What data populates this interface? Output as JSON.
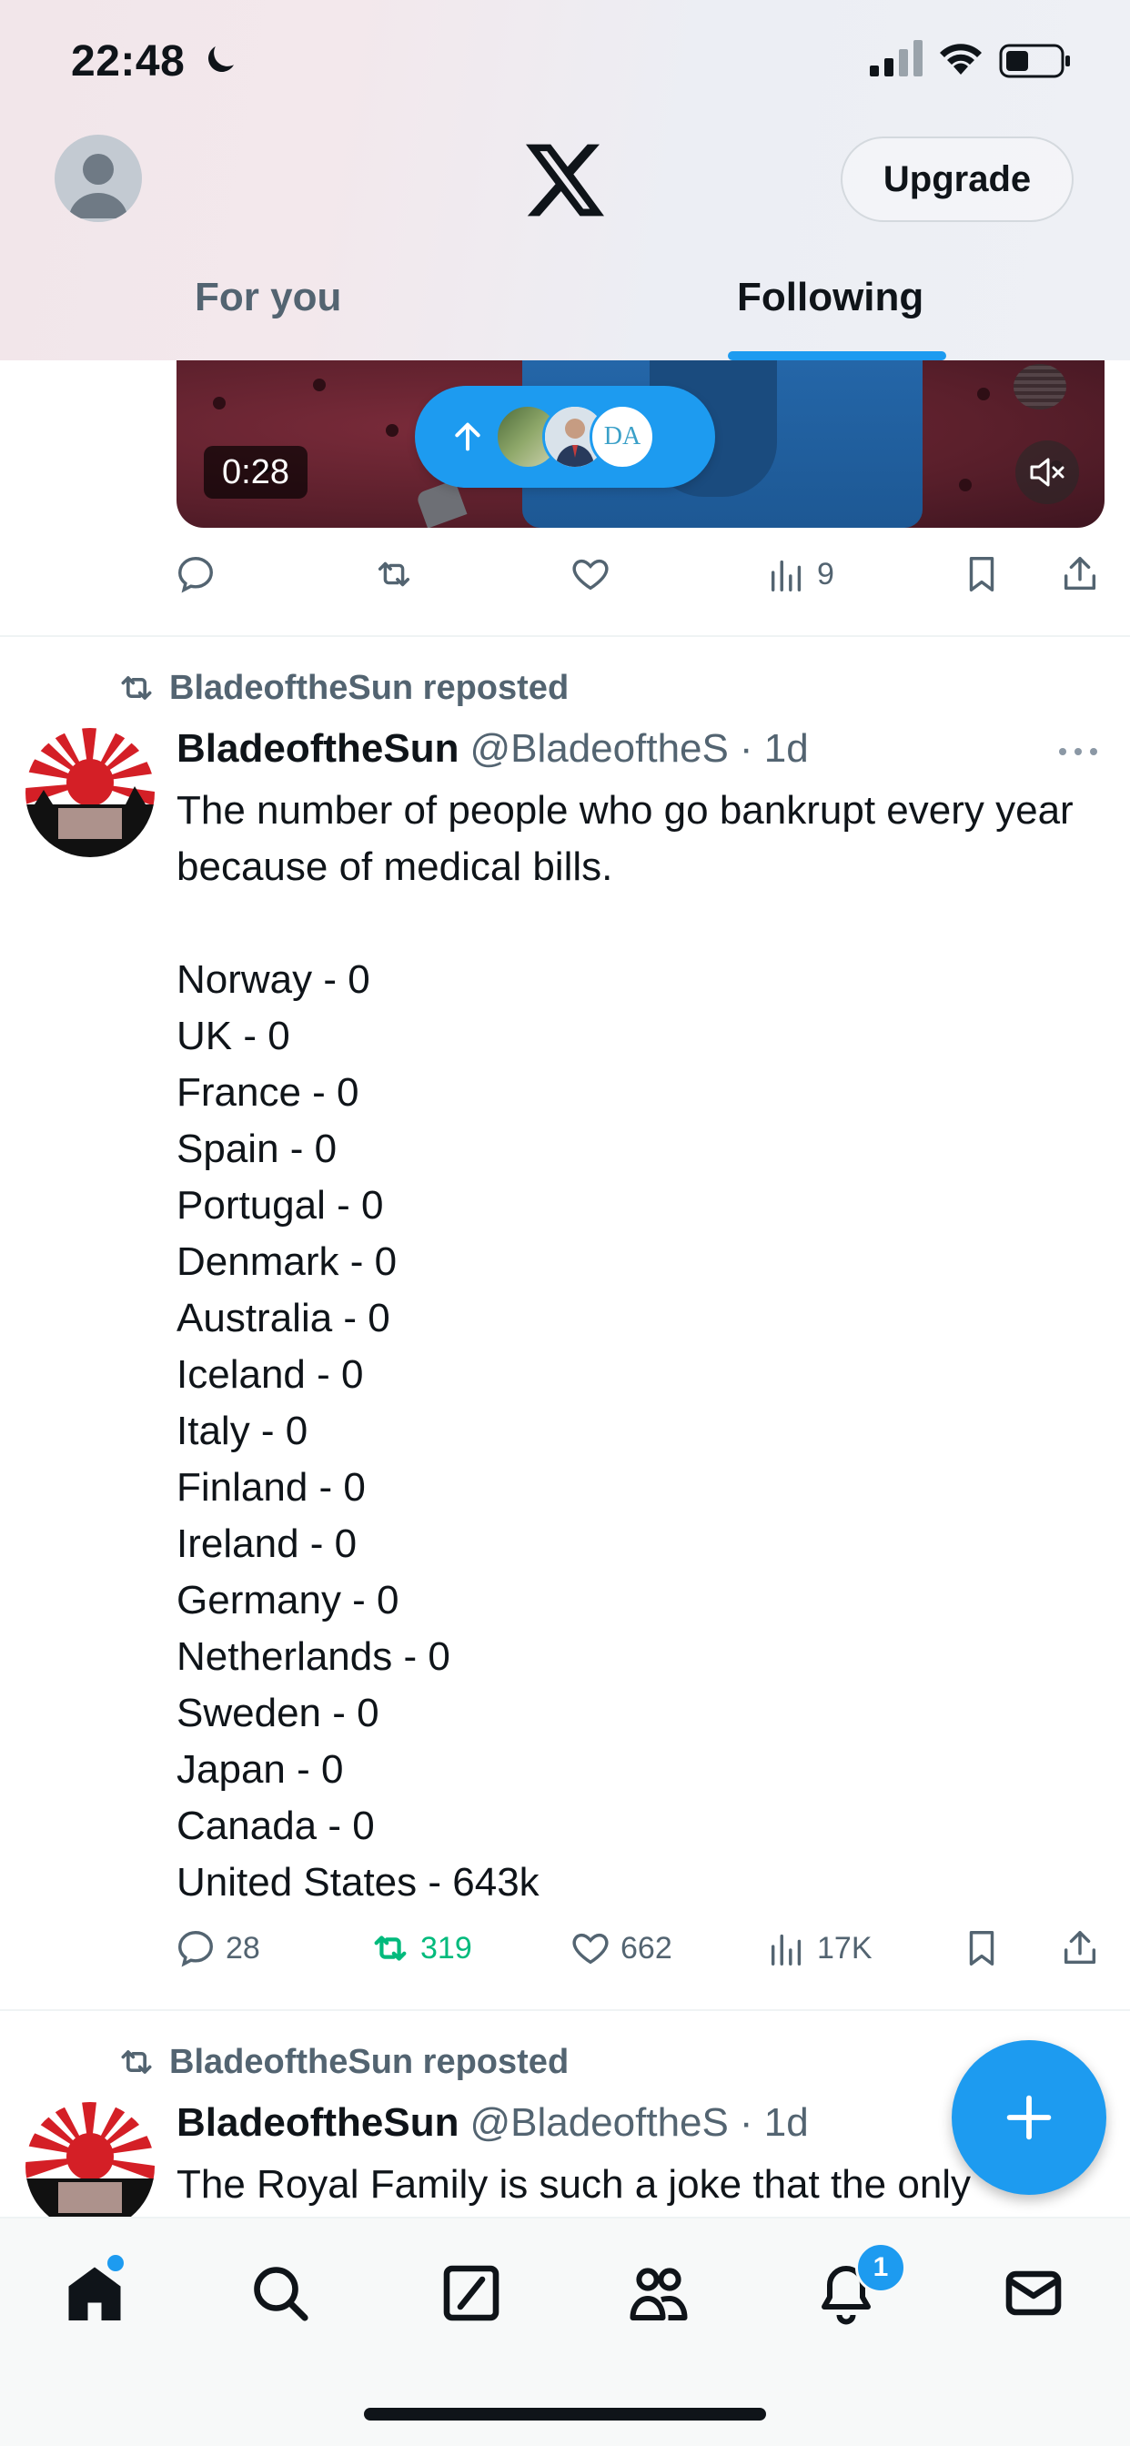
{
  "status_bar": {
    "time": "22:48"
  },
  "header": {
    "upgrade_label": "Upgrade",
    "tabs": [
      {
        "label": "For you",
        "selected": false
      },
      {
        "label": "Following",
        "selected": true
      }
    ]
  },
  "video_post": {
    "duration": "0:28",
    "pill_badge_text": "DA",
    "stats": {
      "replies": "",
      "reposts": "",
      "likes": "",
      "views": "9"
    }
  },
  "tweets": [
    {
      "repost_label": "BladeoftheSun reposted",
      "name": "BladeoftheSun",
      "handle": "@BladeoftheS",
      "time": "· 1d",
      "intro": "The number of people who go bankrupt every year because of medical bills.",
      "list": [
        "Norway - 0",
        "UK - 0",
        "France - 0",
        "Spain - 0",
        "Portugal - 0",
        "Denmark - 0",
        "Australia - 0",
        "Iceland - 0",
        "Italy - 0",
        "Finland - 0",
        "Ireland - 0",
        "Germany - 0",
        "Netherlands - 0",
        "Sweden - 0",
        "Japan - 0",
        "Canada - 0",
        "United States - 643k"
      ],
      "stats": {
        "replies": "28",
        "reposts": "319",
        "likes": "662",
        "views": "17K"
      },
      "reposted_by_me": true
    },
    {
      "repost_label": "BladeoftheSun reposted",
      "name": "BladeoftheSun",
      "handle": "@BladeoftheS",
      "time": "· 1d",
      "intro": "The Royal Family is such a joke that the only"
    }
  ],
  "nav": {
    "notification_count": "1"
  },
  "colors": {
    "accent": "#1d9bf0",
    "repost_green": "#00ba7c",
    "text": "#0f1419",
    "secondary": "#536471"
  }
}
